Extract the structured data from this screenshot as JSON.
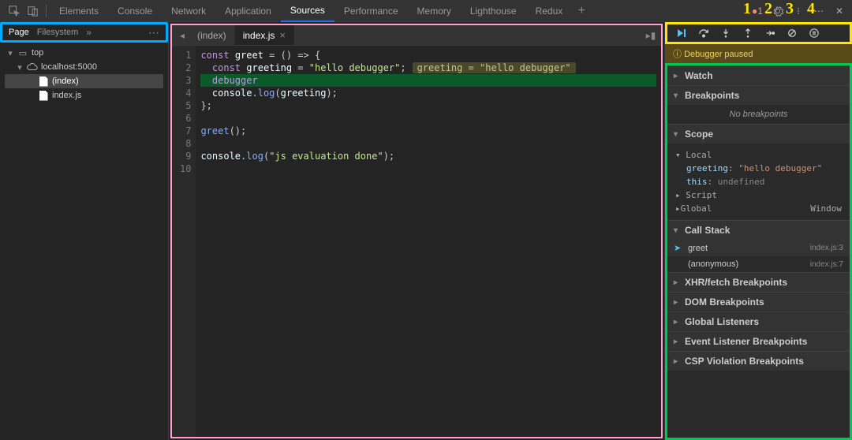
{
  "topTabs": [
    "Elements",
    "Console",
    "Network",
    "Application",
    "Sources",
    "Performance",
    "Memory",
    "Lighthouse",
    "Redux"
  ],
  "topActive": "Sources",
  "errorCount": "1",
  "navTabs": {
    "page": "Page",
    "filesystem": "Filesystem"
  },
  "fileTree": {
    "top": "top",
    "host": "localhost:5000",
    "files": [
      "(index)",
      "index.js"
    ],
    "selected": "(index)"
  },
  "openTabs": [
    "(index)",
    "index.js"
  ],
  "activeOpenTab": "index.js",
  "code": {
    "lines": [
      {
        "n": 1,
        "segs": [
          [
            "kw",
            "const"
          ],
          [
            "pl",
            " "
          ],
          [
            "ident",
            "greet"
          ],
          [
            "pl",
            " = () => {"
          ]
        ]
      },
      {
        "n": 2,
        "segs": [
          [
            "pl",
            "  "
          ],
          [
            "kw",
            "const"
          ],
          [
            "pl",
            " "
          ],
          [
            "ident",
            "greeting"
          ],
          [
            "pl",
            " = "
          ],
          [
            "str",
            "\"hello debugger\""
          ],
          [
            "pl",
            ";"
          ]
        ],
        "inline": "greeting = \"hello debugger\""
      },
      {
        "n": 3,
        "hl": true,
        "segs": [
          [
            "pl",
            "  "
          ],
          [
            "kw",
            "debugger"
          ]
        ]
      },
      {
        "n": 4,
        "segs": [
          [
            "pl",
            "  "
          ],
          [
            "ident",
            "console"
          ],
          [
            "pl",
            "."
          ],
          [
            "fn",
            "log"
          ],
          [
            "pl",
            "("
          ],
          [
            "ident",
            "greeting"
          ],
          [
            "pl",
            ");"
          ]
        ]
      },
      {
        "n": 5,
        "segs": [
          [
            "pl",
            "};"
          ]
        ]
      },
      {
        "n": 6,
        "segs": [
          [
            "pl",
            ""
          ]
        ]
      },
      {
        "n": 7,
        "segs": [
          [
            "fn",
            "greet"
          ],
          [
            "pl",
            "();"
          ]
        ]
      },
      {
        "n": 8,
        "segs": [
          [
            "pl",
            ""
          ]
        ]
      },
      {
        "n": 9,
        "segs": [
          [
            "ident",
            "console"
          ],
          [
            "pl",
            "."
          ],
          [
            "fn",
            "log"
          ],
          [
            "pl",
            "("
          ],
          [
            "str",
            "\"js evaluation done\""
          ],
          [
            "pl",
            ");"
          ]
        ]
      },
      {
        "n": 10,
        "segs": [
          [
            "pl",
            ""
          ]
        ]
      }
    ]
  },
  "debugger": {
    "status": "Debugger paused",
    "panels": {
      "watch": "Watch",
      "breakpoints": "Breakpoints",
      "noBreakpoints": "No breakpoints",
      "scope": "Scope",
      "scopeLocal": "Local",
      "scopeVars": [
        {
          "key": "greeting",
          "val": "\"hello debugger\"",
          "cls": "str"
        },
        {
          "key": "this",
          "val": "undefined",
          "cls": "und"
        }
      ],
      "scopeScript": "Script",
      "scopeGlobal": "Global",
      "scopeGlobalVal": "Window",
      "callStack": "Call Stack",
      "frames": [
        {
          "fn": "greet",
          "loc": "index.js:3",
          "current": true
        },
        {
          "fn": "(anonymous)",
          "loc": "index.js:7",
          "current": false
        }
      ],
      "xhr": "XHR/fetch Breakpoints",
      "dom": "DOM Breakpoints",
      "globalListeners": "Global Listeners",
      "eventListener": "Event Listener Breakpoints",
      "csp": "CSP Violation Breakpoints"
    }
  },
  "annot": "1 2 3 4"
}
